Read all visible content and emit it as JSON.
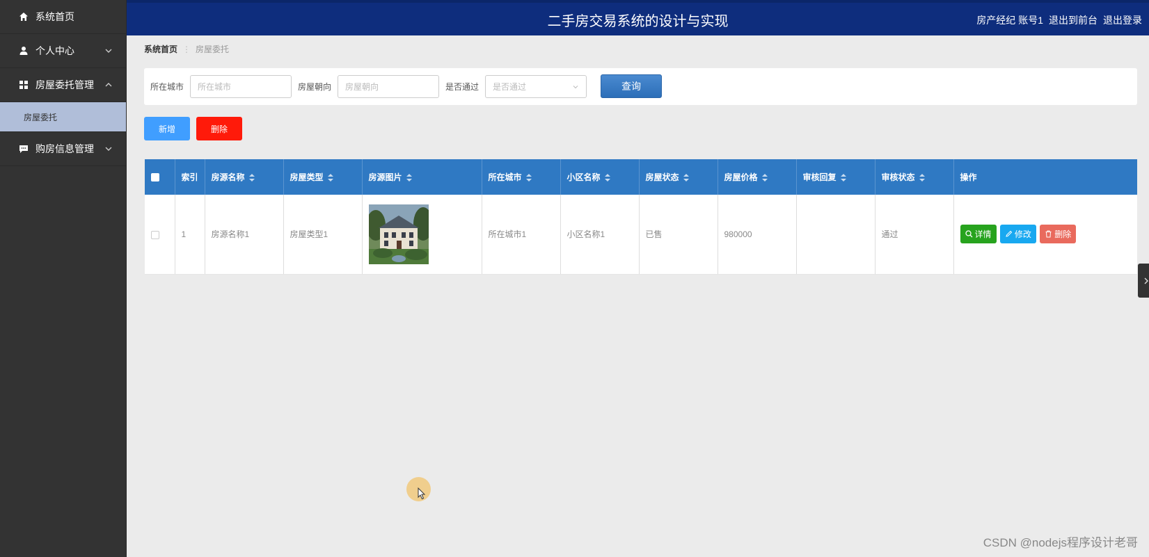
{
  "sidebar": {
    "items": [
      {
        "label": "系统首页",
        "icon": "home-icon"
      },
      {
        "label": "个人中心",
        "icon": "user-icon"
      },
      {
        "label": "房屋委托管理",
        "icon": "grid-icon"
      },
      {
        "label": "购房信息管理",
        "icon": "chat-icon"
      }
    ],
    "submenu": {
      "label": "房屋委托"
    }
  },
  "header": {
    "title": "二手房交易系统的设计与实现",
    "role": "房产经纪",
    "account": "账号1",
    "to_frontend": "退出到前台",
    "logout": "退出登录"
  },
  "breadcrumb": {
    "home": "系统首页",
    "separator": "⋮",
    "current": "房屋委托"
  },
  "search": {
    "city_label": "所在城市",
    "city_placeholder": "所在城市",
    "orientation_label": "房屋朝向",
    "orientation_placeholder": "房屋朝向",
    "approved_label": "是否通过",
    "approved_placeholder": "是否通过",
    "query_label": "查询"
  },
  "actions": {
    "add_label": "新增",
    "delete_label": "删除"
  },
  "table": {
    "headers": [
      "索引",
      "房源名称",
      "房屋类型",
      "房源图片",
      "所在城市",
      "小区名称",
      "房屋状态",
      "房屋价格",
      "审核回复",
      "审核状态",
      "操作"
    ],
    "rows": [
      {
        "index": "1",
        "name": "房源名称1",
        "type": "房屋类型1",
        "image": "house-photo",
        "city": "所在城市1",
        "community": "小区名称1",
        "status": "已售",
        "price": "980000",
        "reply": "",
        "review": "通过"
      }
    ],
    "ops": {
      "detail": "详情",
      "edit": "修改",
      "delete": "删除"
    }
  },
  "colors": {
    "sidebar_bg": "#333333",
    "header_bg": "#0e2d7d",
    "table_header_bg": "#2f79c3",
    "add_btn": "#409eff",
    "delete_btn": "#ff1a0a",
    "detail_btn": "#27a31e",
    "edit_btn": "#18a8f0",
    "row_delete_btn": "#e96a5d"
  },
  "watermark": "CSDN @nodejs程序设计老哥"
}
